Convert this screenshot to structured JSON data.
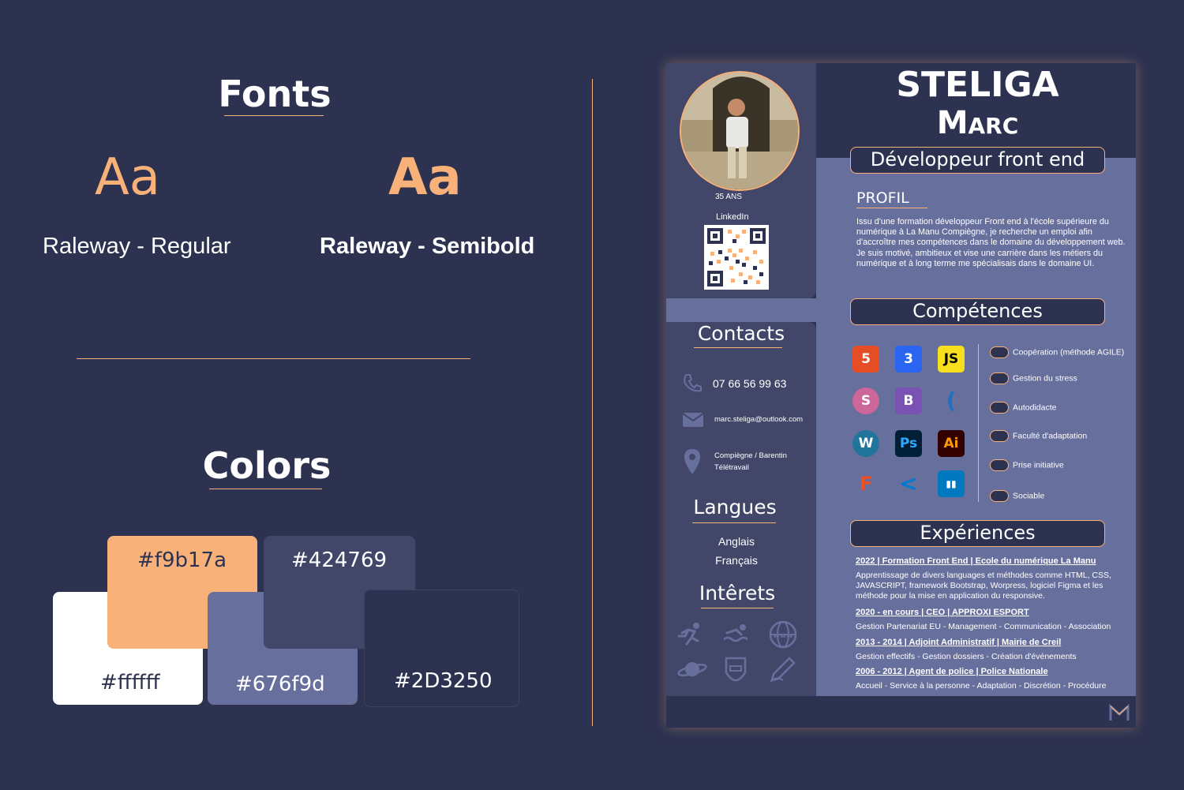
{
  "fonts": {
    "heading": "Fonts",
    "sample_regular": "Aa",
    "sample_semibold": "Aa",
    "regular_name": "Raleway - Regular",
    "semibold_name": "Raleway - Semibold"
  },
  "colors": {
    "heading": "Colors",
    "swatches": [
      {
        "label": "#f9b17a",
        "hex": "#f9b17a"
      },
      {
        "label": "#424769",
        "hex": "#424769"
      },
      {
        "label": "#ffffff",
        "hex": "#ffffff"
      },
      {
        "label": "#676f9d",
        "hex": "#676f9d"
      },
      {
        "label": "#2D3250",
        "hex": "#2d3250"
      }
    ]
  },
  "cv": {
    "last_name": "STELIGA",
    "first_name": "Marc",
    "job_title": "Développeur front end",
    "age": "35 ANS",
    "linkedin_label": "LinkedIn",
    "profile": {
      "title": "PROFIL",
      "text": "Issu d'une formation développeur Front end à l'école supérieure du numérique à La Manu Compiègne, je recherche un emploi afin d'accroître mes compétences dans le domaine du développement web. Je suis motivé, ambitieux  et vise une carrière dans les métiers du numérique et à long terme me spécialisais dans le domaine UI."
    },
    "contacts": {
      "title": "Contacts",
      "phone": "07 66 56 99 63",
      "email": "marc.steliga@outlook.com",
      "location_line1": "Compiègne / Barentin",
      "location_line2": "Télétravail"
    },
    "languages": {
      "title": "Langues",
      "items": [
        "Anglais",
        "Français"
      ]
    },
    "interests": {
      "title": "Intêrets",
      "icons": [
        "running-icon",
        "swimming-icon",
        "web-icon",
        "planet-icon",
        "gaming-icon",
        "drawing-icon"
      ]
    },
    "skills": {
      "title": "Compétences",
      "tech": [
        {
          "label": "5",
          "name": "html5-icon",
          "bg": "#e44d26",
          "fg": "#ffffff"
        },
        {
          "label": "3",
          "name": "css3-icon",
          "bg": "#2965f1",
          "fg": "#ffffff"
        },
        {
          "label": "JS",
          "name": "javascript-icon",
          "bg": "#f7df1e",
          "fg": "#000000"
        },
        {
          "label": "S",
          "name": "sass-icon",
          "bg": "#cd6799",
          "fg": "#ffffff"
        },
        {
          "label": "B",
          "name": "bootstrap-icon",
          "bg": "#7952b3",
          "fg": "#ffffff"
        },
        {
          "label": "(",
          "name": "jquery-icon",
          "bg": "#676f9d",
          "fg": "#1f6fc5"
        },
        {
          "label": "W",
          "name": "wordpress-icon",
          "bg": "#21759b",
          "fg": "#ffffff"
        },
        {
          "label": "Ps",
          "name": "photoshop-icon",
          "bg": "#001e36",
          "fg": "#31a8ff"
        },
        {
          "label": "Ai",
          "name": "illustrator-icon",
          "bg": "#330000",
          "fg": "#ff9a00"
        },
        {
          "label": "F",
          "name": "figma-icon",
          "bg": "#676f9d",
          "fg": "#f24e1e"
        },
        {
          "label": "<",
          "name": "vscode-icon",
          "bg": "#676f9d",
          "fg": "#0078d4"
        },
        {
          "label": "▮▮",
          "name": "trello-icon",
          "bg": "#0079bf",
          "fg": "#ffffff"
        }
      ],
      "soft": [
        "Coopération (méthode AGILE)",
        "Gestion du stress",
        "Autodidacte",
        "Faculté d'adaptation",
        "Prise initiative",
        "Sociable"
      ]
    },
    "experiences": {
      "title": "Expériences",
      "items": [
        {
          "heading": "2022 | Formation Front End | Ecole du numérique La Manu",
          "text": "Apprentissage de divers languages et méthodes comme HTML, CSS, JAVASCRIPT, framework Bootstrap, Worpress, logiciel Figma et les méthode pour la mise en application du responsive."
        },
        {
          "heading": "2020 - en cours | CEO | APPROXI ESPORT",
          "text": "Gestion Partenariat EU - Management - Communication - Association"
        },
        {
          "heading": "2013 - 2014 | Adjoint Administratif | Mairie de Creil",
          "text": "Gestion effectifs - Gestion dossiers - Création d'événements"
        },
        {
          "heading": "2006 - 2012 | Agent de police | Police Nationale",
          "text": "Accueil - Service à la personne - Adaptation - Discrétion - Procédure"
        }
      ]
    }
  }
}
